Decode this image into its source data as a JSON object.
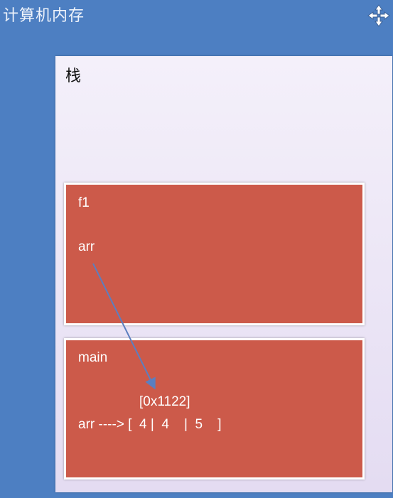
{
  "window": {
    "title": "计算机内存"
  },
  "stack": {
    "label": "栈",
    "frames": [
      {
        "name": "f1",
        "variable": "arr"
      },
      {
        "name": "main",
        "address": "[0x1122]",
        "variable_line": "arr ----> [  4 |  4    |  5    ]"
      }
    ]
  },
  "icons": {
    "move": "move-icon"
  },
  "colors": {
    "background": "#4d7fc2",
    "frame": "#cc5a4a",
    "pointer_arrow": "#5b7fc0"
  }
}
